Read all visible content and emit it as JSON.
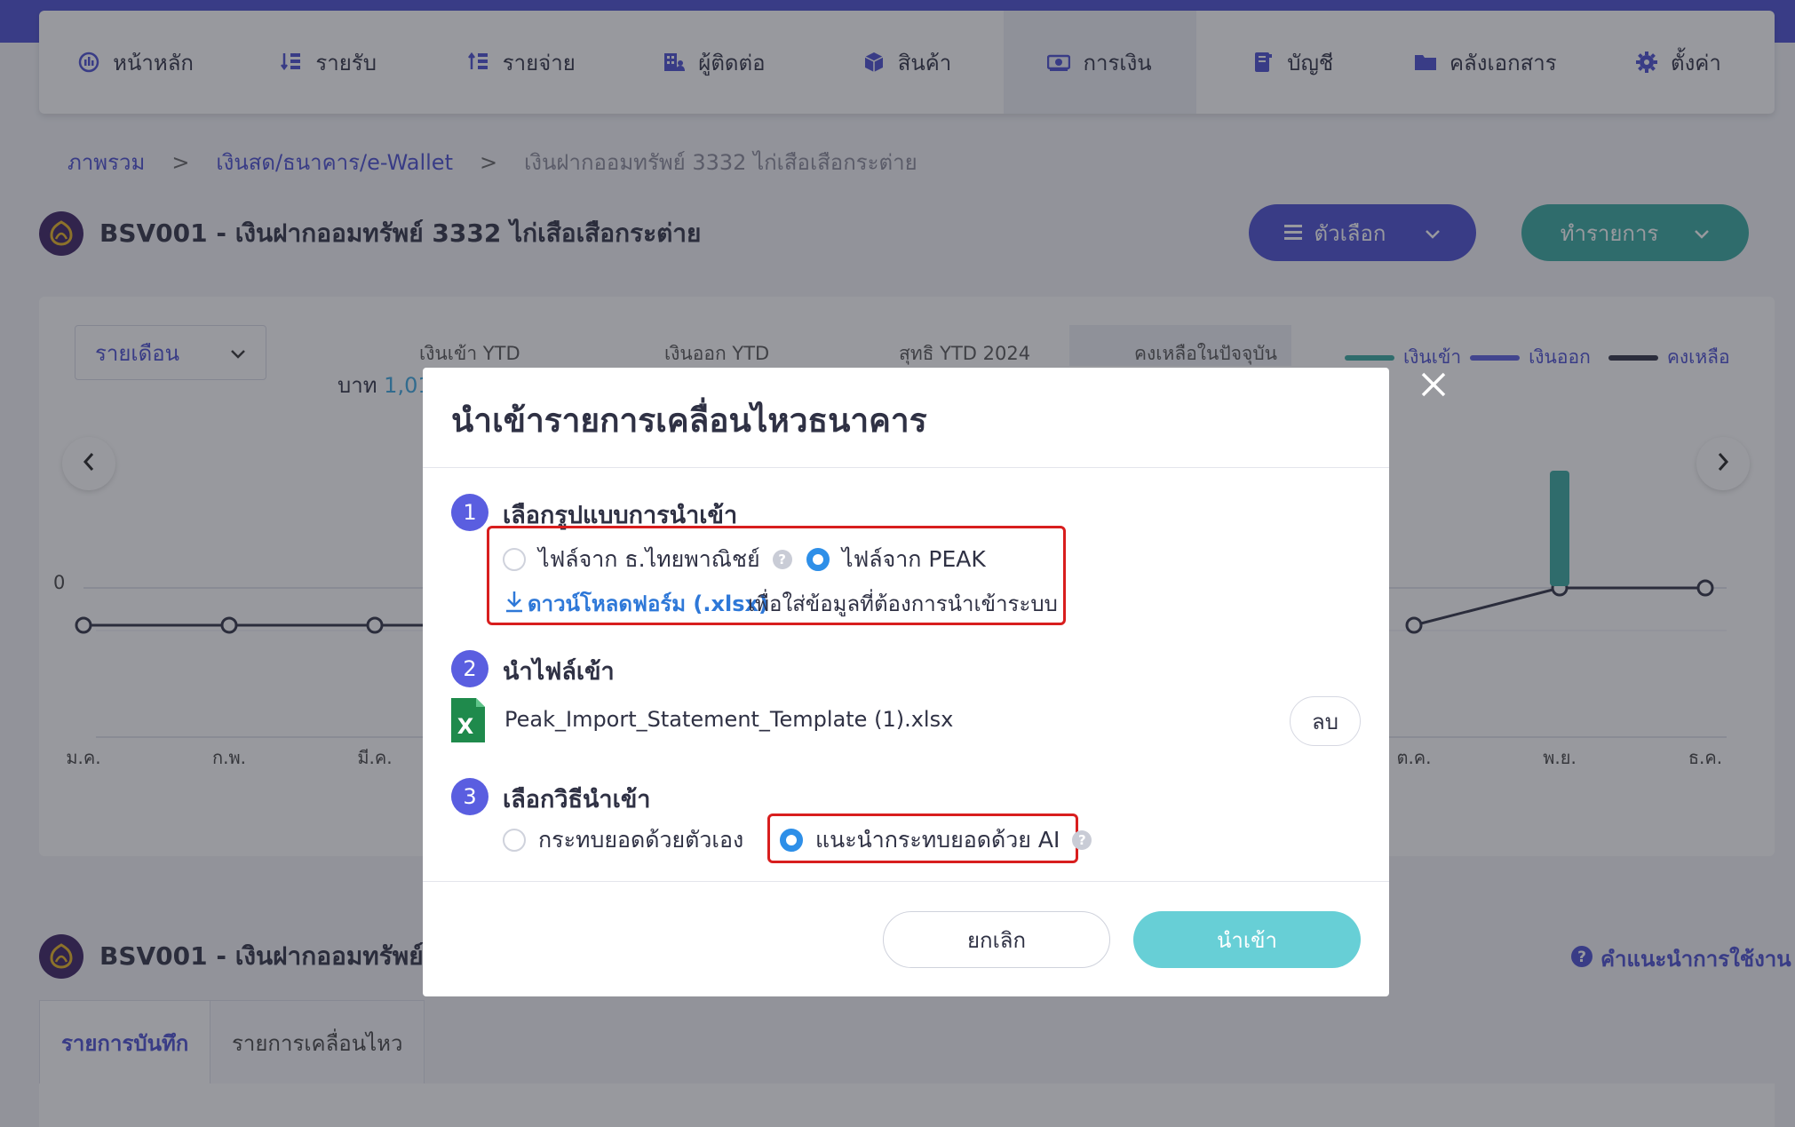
{
  "nav": {
    "items": [
      {
        "label": "หน้าหลัก",
        "icon": "dashboard-icon"
      },
      {
        "label": "รายรับ",
        "icon": "income-list-icon"
      },
      {
        "label": "รายจ่าย",
        "icon": "expense-list-icon"
      },
      {
        "label": "ผู้ติดต่อ",
        "icon": "contacts-icon"
      },
      {
        "label": "สินค้า",
        "icon": "box-icon"
      },
      {
        "label": "การเงิน",
        "icon": "money-icon"
      },
      {
        "label": "บัญชี",
        "icon": "ledger-icon"
      },
      {
        "label": "คลังเอกสาร",
        "icon": "folder-icon"
      },
      {
        "label": "ตั้งค่า",
        "icon": "gear-icon"
      }
    ],
    "active_index": 5
  },
  "breadcrumb": {
    "home": "ภาพรวม",
    "section": "เงินสด/ธนาคาร/e-Wallet",
    "current": "เงินฝากออมทรัพย์ 3332 ไก่เสือเสือกระต่าย",
    "separator": ">"
  },
  "account": {
    "title": "BSV001 - เงินฝากออมทรัพย์ 3332 ไก่เสือเสือกระต่าย",
    "title_truncated": "BSV001 - เงินฝากออมทรัพย์ 3",
    "logo_color": "#3b1f63"
  },
  "header_buttons": {
    "options_label": "ตัวเลือก",
    "action_label": "ทำรายการ"
  },
  "summary": {
    "period": "รายเดือน",
    "stats": [
      "เงินเข้า YTD",
      "เงินออก YTD",
      "สุทธิ YTD 2024",
      "คงเหลือในปัจจุบัน"
    ],
    "baht_prefix": "บาท",
    "baht_value_partial": "1,01",
    "legend": [
      {
        "label": "เงินเข้า",
        "color": "#36aaa0"
      },
      {
        "label": "เงินออก",
        "color": "#5a5ee0"
      },
      {
        "label": "คงเหลือ",
        "color": "#2f3144"
      }
    ],
    "zero_label": "0"
  },
  "chart_data": {
    "type": "line",
    "x_visible": [
      "ม.ค.",
      "ก.พ.",
      "มี.ค.",
      "ต.ค.",
      "พ.ย.",
      "ธ.ค."
    ],
    "y_tick": "0",
    "series": [
      {
        "name": "เงินเข้า",
        "bars": [
          {
            "x": "พ.ย.",
            "value": 1
          }
        ]
      },
      {
        "name": "คงเหลือ",
        "values_visible": [
          0,
          0,
          0,
          0,
          1,
          1
        ]
      }
    ]
  },
  "lower": {
    "help_label": "คำแนะนำการใช้งาน",
    "tabs": [
      "รายการบันทึก",
      "รายการเคลื่อนไหว"
    ]
  },
  "modal": {
    "title": "นำเข้ารายการเคลื่อนไหวธนาคาร",
    "steps": [
      {
        "number": "1",
        "title": "เลือกรูปแบบการนำเข้า"
      },
      {
        "number": "2",
        "title": "นำไฟล์เข้า"
      },
      {
        "number": "3",
        "title": "เลือกวิธีนำเข้า"
      }
    ],
    "format_options": [
      {
        "label": "ไฟล์จาก ธ.ไทยพาณิชย์",
        "checked": false,
        "help": true
      },
      {
        "label": "ไฟล์จาก PEAK",
        "checked": true,
        "help": false
      }
    ],
    "download_link": "ดาวน์โหลดฟอร์ม (.xlsx)",
    "download_note": "เพื่อใส่ข้อมูลที่ต้องการนำเข้าระบบ",
    "file_name": "Peak_Import_Statement_Template (1).xlsx",
    "delete_label": "ลบ",
    "method_options": [
      {
        "label": "กระทบยอดด้วยตัวเอง",
        "checked": false
      },
      {
        "label": "แนะนำกระทบยอดด้วย AI",
        "checked": true
      }
    ],
    "help_mark": "?",
    "cancel_label": "ยกเลิก",
    "import_label": "นำเข้า"
  }
}
